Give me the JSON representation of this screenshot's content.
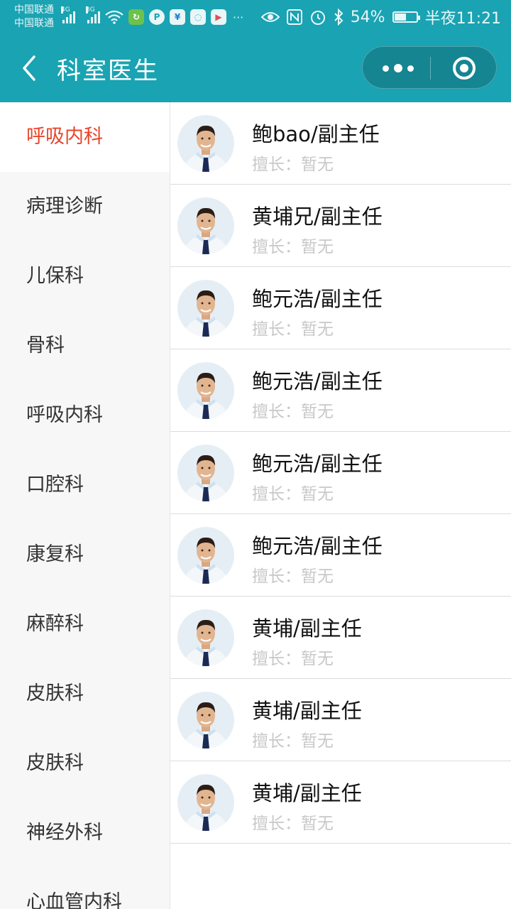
{
  "status_bar": {
    "carrier_1": "中国联通",
    "carrier_2": "中国联通",
    "signal_1_tag": "4G",
    "signal_2_tag": "3G",
    "battery_percent": "54%",
    "battery_level": 0.54,
    "time": "半夜11:21"
  },
  "nav": {
    "title": "科室医生"
  },
  "sidebar": {
    "items": [
      {
        "label": "呼吸内科",
        "active": true
      },
      {
        "label": "病理诊断"
      },
      {
        "label": "儿保科"
      },
      {
        "label": "骨科"
      },
      {
        "label": "呼吸内科"
      },
      {
        "label": "口腔科"
      },
      {
        "label": "康复科"
      },
      {
        "label": "麻醉科"
      },
      {
        "label": "皮肤科"
      },
      {
        "label": "皮肤科"
      },
      {
        "label": "神经外科"
      },
      {
        "label": "心血管内科"
      }
    ]
  },
  "doctors": [
    {
      "name": "鲍bao/副主任",
      "skill": "擅长：暂无"
    },
    {
      "name": "黄埔兄/副主任",
      "skill": "擅长：暂无"
    },
    {
      "name": "鲍元浩/副主任",
      "skill": "擅长：暂无"
    },
    {
      "name": "鲍元浩/副主任",
      "skill": "擅长：暂无"
    },
    {
      "name": "鲍元浩/副主任",
      "skill": "擅长：暂无"
    },
    {
      "name": "鲍元浩/副主任",
      "skill": "擅长：暂无"
    },
    {
      "name": "黄埔/副主任",
      "skill": "擅长：暂无"
    },
    {
      "name": "黄埔/副主任",
      "skill": "擅长：暂无"
    },
    {
      "name": "黄埔/副主任",
      "skill": "擅长：暂无"
    }
  ],
  "colors": {
    "theme": "#1aa3b2",
    "active_dept": "#e8452b",
    "skill_text": "#c8c8c8"
  }
}
